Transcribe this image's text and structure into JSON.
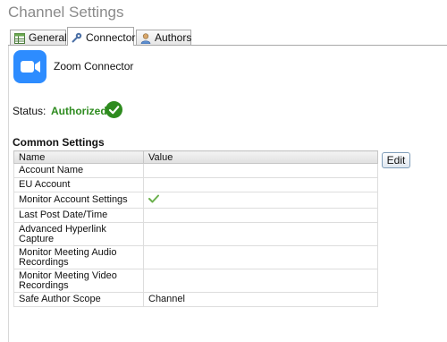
{
  "window": {
    "title": "Channel Settings"
  },
  "tabs": [
    {
      "label": "General",
      "icon": "table-icon",
      "active": false
    },
    {
      "label": "Connector",
      "icon": "plug-icon",
      "active": true
    },
    {
      "label": "Authors",
      "icon": "person-icon",
      "active": false
    }
  ],
  "connector": {
    "name": "Zoom Connector",
    "logo": "zoom-camera-icon",
    "brand_color": "#2d8cff"
  },
  "status": {
    "label": "Status:",
    "value": "Authorized",
    "color": "#2e8b1f",
    "icon": "check-circle-icon"
  },
  "common_settings": {
    "title": "Common Settings",
    "edit_label": "Edit",
    "columns": [
      "Name",
      "Value"
    ],
    "rows": [
      {
        "name": "Account Name",
        "value": ""
      },
      {
        "name": "EU Account",
        "value": ""
      },
      {
        "name": "Monitor Account Settings",
        "value": "",
        "checked": true
      },
      {
        "name": "Last Post Date/Time",
        "value": ""
      },
      {
        "name": "Advanced Hyperlink Capture",
        "value": ""
      },
      {
        "name": "Monitor Meeting Audio Recordings",
        "value": ""
      },
      {
        "name": "Monitor Meeting Video Recordings",
        "value": ""
      },
      {
        "name": "Safe Author Scope",
        "value": "Channel"
      }
    ]
  }
}
